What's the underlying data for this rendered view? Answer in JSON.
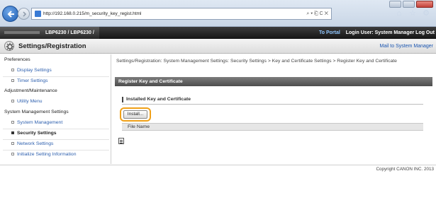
{
  "browser": {
    "url": "http://192.168.0.215/m_security_key_regist.html",
    "address_tools": "⌕ ▾ ⎗ C ✕"
  },
  "app": {
    "product": "LBP6230 / LBP6230 /",
    "portal_link": "To Portal",
    "login_text": "Login User: System Manager Log Out"
  },
  "header": {
    "title": "Settings/Registration",
    "mail_link": "Mail to System Manager"
  },
  "sidebar": {
    "groups": [
      {
        "label": "Preferences"
      },
      {
        "label": "Adjustment/Maintenance"
      },
      {
        "label": "System Management Settings"
      }
    ],
    "items": [
      {
        "label": "Display Settings"
      },
      {
        "label": "Timer Settings"
      },
      {
        "label": "Utility Menu"
      },
      {
        "label": "System Management"
      },
      {
        "label": "Security Settings"
      },
      {
        "label": "Network Settings"
      },
      {
        "label": "Initialize Setting Information"
      }
    ]
  },
  "main": {
    "breadcrumb": "Settings/Registration: System Management Settings: Security Settings > Key and Certificate Settings > Register Key and Certificate",
    "section_title": "Register Key and Certificate",
    "subheading": "Installed Key and Certificate",
    "install_button": "Install...",
    "table_header": "File Name"
  },
  "footer": {
    "copyright": "Copyright CANON INC. 2013"
  },
  "colors": {
    "highlight": "#f0a018",
    "link": "#2d5fae"
  }
}
